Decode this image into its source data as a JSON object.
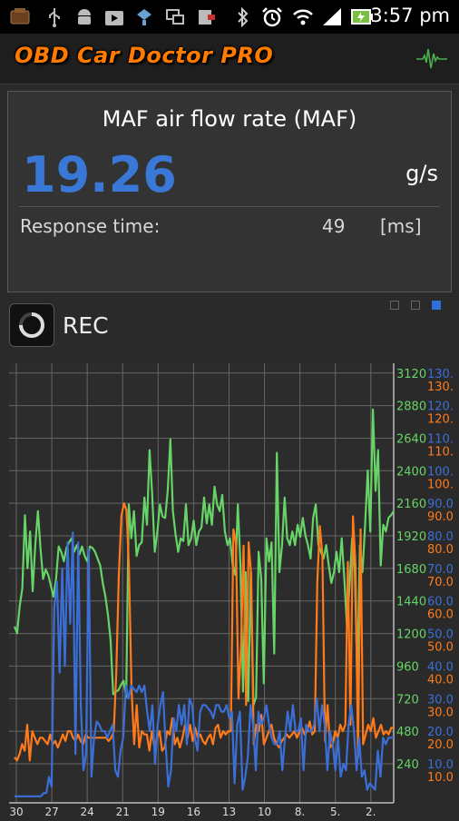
{
  "status_bar": {
    "time": "3:57 pm",
    "icons": [
      "app-icon",
      "usb-icon",
      "android-debug-icon",
      "shop-icon",
      "notification-icon",
      "screen-icon",
      "sd-icon",
      "bluetooth-icon",
      "alarm-icon",
      "wifi-icon",
      "signal-icon",
      "battery-icon"
    ]
  },
  "app_bar": {
    "title": "OBD Car Doctor PRO",
    "pulse_icon": "pulse-icon"
  },
  "sensor": {
    "name": "MAF air flow rate (MAF)",
    "value": "19.26",
    "unit": "g/s",
    "response_label": "Response time:",
    "response_value": "49",
    "response_unit": "[ms]"
  },
  "page_dots": {
    "count": 3,
    "active_index": 2,
    "active_color": "#2f6fd6"
  },
  "rec": {
    "label": "REC"
  },
  "colors": {
    "green": "#66d466",
    "orange": "#ff7a1a",
    "blue": "#3a6fd8"
  },
  "chart_data": {
    "type": "line",
    "x_ticks": [
      "30",
      "27",
      "24",
      "21",
      "19",
      "16",
      "13",
      "10",
      "8.",
      "5.",
      "2."
    ],
    "y_axes": [
      {
        "color": "#66d466",
        "ticks": [
          "3120",
          "2880",
          "2640",
          "2400",
          "2160",
          "1920",
          "1680",
          "1440",
          "1200",
          "960",
          "720",
          "480",
          "240"
        ]
      },
      {
        "color": "#3a6fd8",
        "ticks": [
          "130.",
          "120.",
          "110.",
          "100.",
          "90.0",
          "80.0",
          "70.0",
          "60.0",
          "50.0",
          "40.0",
          "30.0",
          "20.0",
          "10.0"
        ]
      },
      {
        "color": "#ff7a1a",
        "ticks": [
          "130.",
          "120.",
          "110.",
          "100.",
          "90.0",
          "80.0",
          "70.0",
          "60.0",
          "50.0",
          "40.0",
          "30.0",
          "20.0",
          "10.0"
        ]
      }
    ],
    "ylim_green": [
      0,
      3240
    ],
    "ylim_blue": [
      0,
      135
    ],
    "ylim_orange": [
      0,
      135
    ],
    "series": [
      {
        "color": "#66d466",
        "axis": "green",
        "values": [
          1300,
          1250,
          1450,
          1580,
          2120,
          1730,
          2000,
          1560,
          1900,
          2150,
          1880,
          1650,
          1720,
          1680,
          1600,
          1520,
          1650,
          1890,
          1850,
          1780,
          1880,
          1920,
          1950,
          1850,
          1900,
          1830,
          1890,
          1820,
          1780,
          1890,
          1880,
          1850,
          1800,
          1750,
          1620,
          1520,
          1380,
          1200,
          800,
          820,
          830,
          870,
          900,
          780,
          2200,
          1950,
          2150,
          1820,
          1900,
          1920,
          2250,
          2050,
          2600,
          2280,
          1850,
          2000,
          2200,
          2110,
          2100,
          2300,
          2680,
          2150,
          1980,
          1850,
          1950,
          1930,
          2200,
          1900,
          1950,
          2080,
          1900,
          2000,
          2030,
          2250,
          2060,
          2200,
          2050,
          2330,
          2200,
          2150,
          2270,
          2000,
          1900,
          1950,
          1750,
          1680,
          2200,
          1750,
          820,
          1700,
          750,
          1700,
          720,
          780,
          1850,
          1650,
          880,
          1950,
          1780,
          1920,
          1100,
          2580,
          1700,
          1900,
          2250,
          1950,
          1900,
          2000,
          1900,
          2050,
          1960,
          2100,
          1970,
          1900,
          1800,
          2100,
          2200,
          1900,
          1850,
          1800,
          1900,
          1750,
          1620,
          1700,
          1850,
          1700,
          1950,
          1650,
          1300,
          1600,
          1950,
          1720,
          900,
          1900,
          1700,
          2050,
          2450,
          2000,
          2900,
          2300,
          2600,
          1750,
          2050,
          2000,
          2100,
          2120,
          2150
        ]
      },
      {
        "color": "#ff7a1a",
        "axis": "orange",
        "values": [
          14,
          13,
          15,
          18,
          16,
          24,
          13,
          22,
          20,
          18,
          20,
          20,
          19,
          18,
          21,
          18,
          19,
          17,
          19,
          21,
          19,
          22,
          22,
          20,
          19,
          21,
          19,
          18,
          21,
          20,
          20,
          20,
          20,
          20,
          20,
          20,
          20,
          19,
          20,
          22,
          40,
          70,
          88,
          92,
          90,
          72,
          35,
          18,
          30,
          17,
          22,
          21,
          21,
          16,
          22,
          17,
          20,
          22,
          16,
          17,
          22,
          21,
          26,
          18,
          20,
          17,
          20,
          24,
          20,
          24,
          19,
          23,
          20,
          21,
          19,
          18,
          20,
          21,
          18,
          23,
          24,
          20,
          22,
          21,
          22,
          22,
          84,
          80,
          32,
          48,
          79,
          30,
          80,
          70,
          18,
          24,
          22,
          27,
          18,
          20,
          22,
          24,
          20,
          18,
          17,
          19,
          20,
          21,
          20,
          21,
          22,
          20,
          22,
          23,
          21,
          22,
          25,
          21,
          22,
          68,
          85,
          76,
          19,
          30,
          17,
          18,
          22,
          20,
          24,
          22,
          24,
          74,
          24,
          88,
          73,
          14,
          84,
          18,
          21,
          24,
          22,
          26,
          20,
          22,
          24,
          21,
          22,
          21,
          23,
          23
        ]
      },
      {
        "color": "#3a6fd8",
        "axis": "blue",
        "values": [
          2,
          2,
          2,
          2,
          2,
          2,
          2,
          2,
          2,
          2,
          2,
          3,
          3,
          8,
          5,
          60,
          68,
          40,
          72,
          42,
          80,
          55,
          83,
          15,
          80,
          30,
          10,
          15,
          78,
          8,
          20,
          25,
          24,
          22,
          22,
          20,
          22,
          24,
          10,
          8,
          16,
          20,
          36,
          32,
          36,
          35,
          34,
          36,
          34,
          36,
          28,
          22,
          30,
          12,
          24,
          30,
          34,
          18,
          5,
          10,
          26,
          22,
          30,
          24,
          30,
          18,
          32,
          30,
          20,
          16,
          28,
          30,
          30,
          29,
          28,
          26,
          30,
          30,
          28,
          28,
          30,
          26,
          28,
          6,
          24,
          28,
          4,
          8,
          14,
          30,
          24,
          10,
          28,
          24,
          26,
          30,
          24,
          20,
          18,
          18,
          22,
          10,
          20,
          28,
          22,
          30,
          22,
          22,
          26,
          10,
          24,
          22,
          22,
          24,
          32,
          22,
          30,
          24,
          10,
          22,
          18,
          10,
          20,
          8,
          12,
          10,
          24,
          30,
          22,
          10,
          20,
          8,
          10,
          4,
          6,
          5,
          4,
          16,
          8,
          20,
          18,
          20,
          20,
          20
        ]
      }
    ]
  }
}
